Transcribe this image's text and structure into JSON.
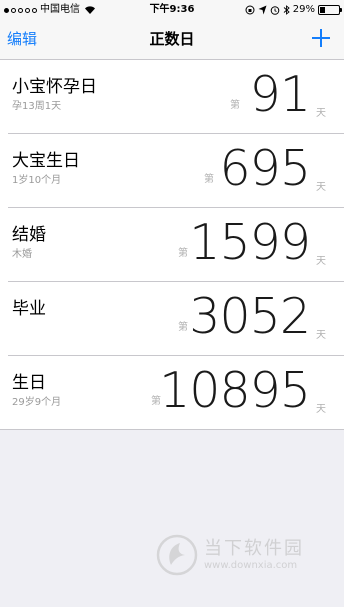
{
  "status_bar": {
    "carrier": "中国电信",
    "time": "下午9:36",
    "battery": "29%",
    "battery_level": 0.29
  },
  "nav": {
    "edit_label": "编辑",
    "title": "正数日",
    "add_icon": "plus-icon"
  },
  "events": [
    {
      "title": "小宝怀孕日",
      "subtitle": "孕13周1天",
      "prefix": "第",
      "count": "91",
      "suffix": "天"
    },
    {
      "title": "大宝生日",
      "subtitle": "1岁10个月",
      "prefix": "第",
      "count": "695",
      "suffix": "天"
    },
    {
      "title": "结婚",
      "subtitle": "木婚",
      "prefix": "第",
      "count": "1599",
      "suffix": "天"
    },
    {
      "title": "毕业",
      "subtitle": "",
      "prefix": "第",
      "count": "3052",
      "suffix": "天"
    },
    {
      "title": "生日",
      "subtitle": "29岁9个月",
      "prefix": "第",
      "count": "10895",
      "suffix": "天"
    }
  ],
  "watermark": {
    "name": "当下软件园",
    "url": "www.downxia.com"
  },
  "colors": {
    "accent": "#147efb",
    "background": "#efeff4"
  }
}
